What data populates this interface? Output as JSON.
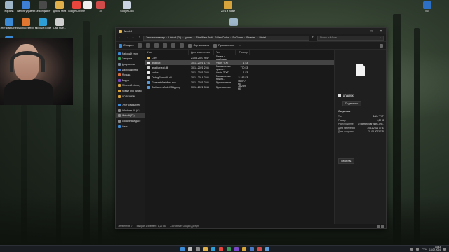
{
  "desktop_icons": [
    {
      "label": "Корзина",
      "color": "#9fb6c9"
    },
    {
      "label": "Панель управления",
      "color": "#3d7fd6"
    },
    {
      "label": "Бесконфликт",
      "color": "#4a4a4a"
    },
    {
      "label": "для из тела",
      "color": "#e0b04a"
    },
    {
      "label": "Google Chrome",
      "color": "#e8453c"
    },
    {
      "label": "",
      "color": "#eee"
    },
    {
      "label": "10",
      "color": "#d24b4b"
    },
    {
      "label": "Google Dock",
      "color": "#c9d4e0"
    },
    {
      "label": "2021 в папке",
      "color": "#d7a43c"
    },
    {
      "label": "x64",
      "color": "#2d6fc5"
    },
    {
      "label": "Этот компьютер",
      "color": "#3a8ad6"
    },
    {
      "label": "Mozilla Firefox",
      "color": "#e0762f"
    },
    {
      "label": "Microsoft Edge",
      "color": "#2d9fd6"
    },
    {
      "label": "Dall_Rule...",
      "color": "#cfcfcf"
    },
    {
      "label": "Сеть",
      "color": "#3a8ad6"
    },
    {
      "label": "Корзина",
      "color": "#a0b8cc"
    }
  ],
  "window": {
    "title": "Model",
    "breadcrumbs": [
      "Этот компьютер",
      "Ubisoft (D:)",
      "games",
      "Star Wars Jedi - Fallen Order",
      "SwGame",
      "Binaries",
      "Model"
    ],
    "search_placeholder": "Поиск в: Model",
    "toolbar": {
      "create": "Создать",
      "sort": "Сортировать",
      "view": "Просмотреть",
      "more": "..."
    },
    "nav": [
      {
        "label": "Рабочий стол",
        "color": "#3a8ad6",
        "sel": false
      },
      {
        "label": "Загрузки",
        "color": "#3a9a5a",
        "sel": false
      },
      {
        "label": "Документы",
        "color": "#7a8a9a",
        "sel": false
      },
      {
        "label": "Изображения",
        "color": "#4a7ac6",
        "sel": false
      },
      {
        "label": "Музыка",
        "color": "#d96a3a",
        "sel": false
      },
      {
        "label": "Видео",
        "color": "#7a4ac6",
        "sel": false
      },
      {
        "label": "Minecraft Library",
        "color": "#d7a43c",
        "sel": false
      },
      {
        "label": "новые обо видео",
        "color": "#d7a43c",
        "sel": false
      },
      {
        "label": "SDPKIMENI",
        "color": "#d7a43c",
        "sel": false
      },
      {
        "label": "gap",
        "color": "",
        "sel": false
      },
      {
        "label": "Этот компьютер",
        "color": "#3a8ad6",
        "sel": false
      },
      {
        "label": "Windows 10 (C:)",
        "color": "#888",
        "sel": false
      },
      {
        "label": "Ubisoft (D:)",
        "color": "#888",
        "sel": true
      },
      {
        "label": "Локальный диск",
        "color": "#888",
        "sel": false
      },
      {
        "label": "Сеть",
        "color": "#3a8ad6",
        "sel": false
      }
    ],
    "columns": [
      "Имя",
      "Дата изменения",
      "Тип",
      "Размер"
    ],
    "files": [
      {
        "name": "Core",
        "date": "21.08.2023 9:47",
        "type": "Папка с файлами",
        "size": "",
        "color": "#e0b04a",
        "sel": false
      },
      {
        "name": "anadiux",
        "date": "30.11.2021 17:53",
        "type": "Файл \"TXT\"",
        "size": "1 КБ",
        "color": "#eeeeee",
        "sel": true
      },
      {
        "name": "anadiuxfeat.dll",
        "date": "30.11.2021 2:46",
        "type": "Расширение прило...",
        "size": "770 КБ",
        "color": "#cccccc",
        "sel": false
      },
      {
        "name": "codex",
        "date": "30.11.2021 2:45",
        "type": "Файл \"TXT\"",
        "size": "1 КБ",
        "color": "#eeeeee",
        "sel": false
      },
      {
        "name": "DiologEtonoBL.dll",
        "date": "30.11.2019 2:46",
        "type": "Расширение прило...",
        "size": "2 183 КБ",
        "color": "#cccccc",
        "sel": false
      },
      {
        "name": "GenerateDebfiles.exe",
        "date": "30.11.2021 2:46",
        "type": "Приложение",
        "size": "46 077 КБ",
        "color": "#5a9ad6",
        "sel": false
      },
      {
        "name": "SwGame-Model-Shipping",
        "date": "30.11.2021 3:44",
        "type": "Приложение",
        "size": "78 289 КБ",
        "color": "#5a9ad6",
        "sel": false
      }
    ],
    "preview": {
      "name": "anadiux",
      "share": "Поделиться",
      "details_heading": "Сведения",
      "rows": [
        {
          "k": "Тип",
          "v": "Файл \"TXT\""
        },
        {
          "k": "Размер",
          "v": "1,22 КБ"
        },
        {
          "k": "Расположение",
          "v": "D:\\games\\Star Wars Jedi..."
        },
        {
          "k": "Дата изменения",
          "v": "30.11.2021 17:53"
        },
        {
          "k": "Дата создания",
          "v": "21.08.2023 7:39"
        }
      ],
      "button": "Свойства"
    },
    "status": {
      "items": "Элементов: 7",
      "selected": "Выбран 1 элемент: 1,22 КБ",
      "state": "Состояние: Общий доступ"
    }
  },
  "taskbar": {
    "icons": [
      "#3a8ad6",
      "#bbbbbb",
      "#8a8a8a",
      "#e0b04a",
      "#2d9fd6",
      "#e8453c",
      "#3a9a5a",
      "#7a4ac6",
      "#d7a43c",
      "#4a7ac6",
      "#d24b4b",
      "#5a9ad6"
    ],
    "lang": "РУС",
    "time": "13:43",
    "date": "18.02.2024"
  }
}
